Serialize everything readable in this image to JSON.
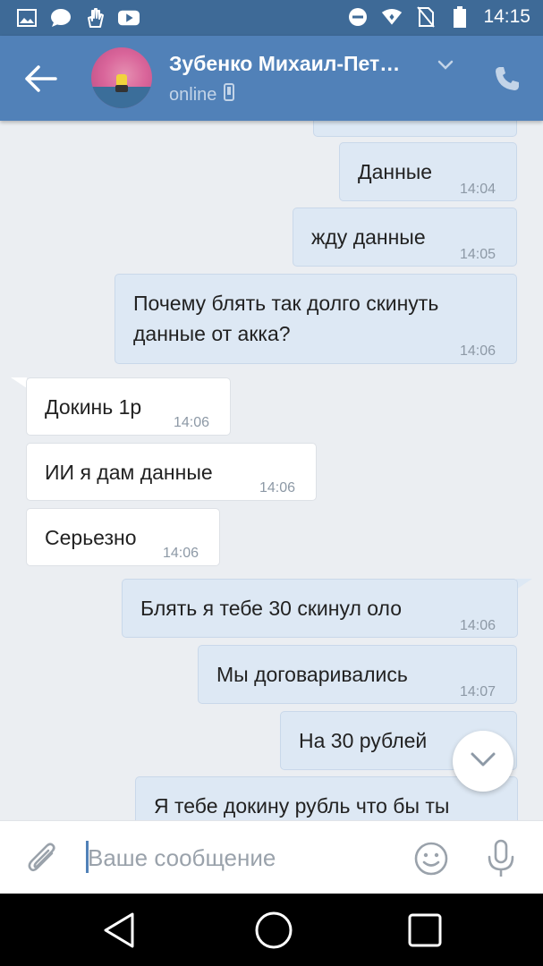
{
  "status_bar": {
    "time": "14:15",
    "icons_left": [
      "image-icon",
      "chat-icon",
      "hand-icon",
      "youtube-icon"
    ],
    "icons_right": [
      "minus-circle-icon",
      "wifi-icon",
      "no-sim-icon",
      "battery-icon"
    ]
  },
  "header": {
    "name": "Зубенко Михаил-Пет…",
    "status": "online",
    "accent": "#5181b8"
  },
  "messages": [
    {
      "dir": "out",
      "text": "Данные",
      "time": "14:04"
    },
    {
      "dir": "out",
      "text": "жду данные",
      "time": "14:05"
    },
    {
      "dir": "out",
      "text": "Почему блять так долго скинуть",
      "text2": "данные от акка?",
      "time": "14:06"
    },
    {
      "dir": "in",
      "text": "Докинь 1р",
      "time": "14:06"
    },
    {
      "dir": "in",
      "text": "ИИ я дам  данные",
      "time": "14:06"
    },
    {
      "dir": "in",
      "text": "Серьезно",
      "time": "14:06"
    },
    {
      "dir": "out",
      "text": "Блять я тебе 30 скинул оло",
      "time": "14:06"
    },
    {
      "dir": "out",
      "text": "Мы договаривались",
      "time": "14:07"
    },
    {
      "dir": "out",
      "text": "На 30 рублей",
      "time": ""
    },
    {
      "dir": "out",
      "text": "Я тебе докину рубль что бы ты",
      "time": ""
    }
  ],
  "input": {
    "placeholder": "Ваше сообщение",
    "value": ""
  }
}
